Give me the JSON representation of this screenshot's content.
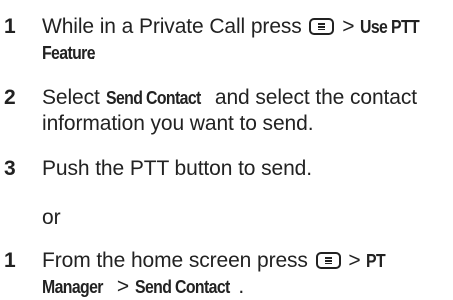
{
  "steps": [
    {
      "number": "1",
      "pre": "While in a Private Call press",
      "sep": ">",
      "bold1": "Use PTT",
      "bold2": "Feature",
      "end": "."
    },
    {
      "number": "2",
      "pre": "Select",
      "bold": "Send Contact",
      "post": "and select the contact information you want to send."
    },
    {
      "number": "3",
      "text": "Push the PTT button to send."
    }
  ],
  "or_text": "or",
  "alt_step": {
    "number": "1",
    "pre": "From the home screen press",
    "sep1": ">",
    "bold1": "PT",
    "bold2": "Manager",
    "sep2": ">",
    "bold3": "Send Contact",
    "end": "."
  }
}
